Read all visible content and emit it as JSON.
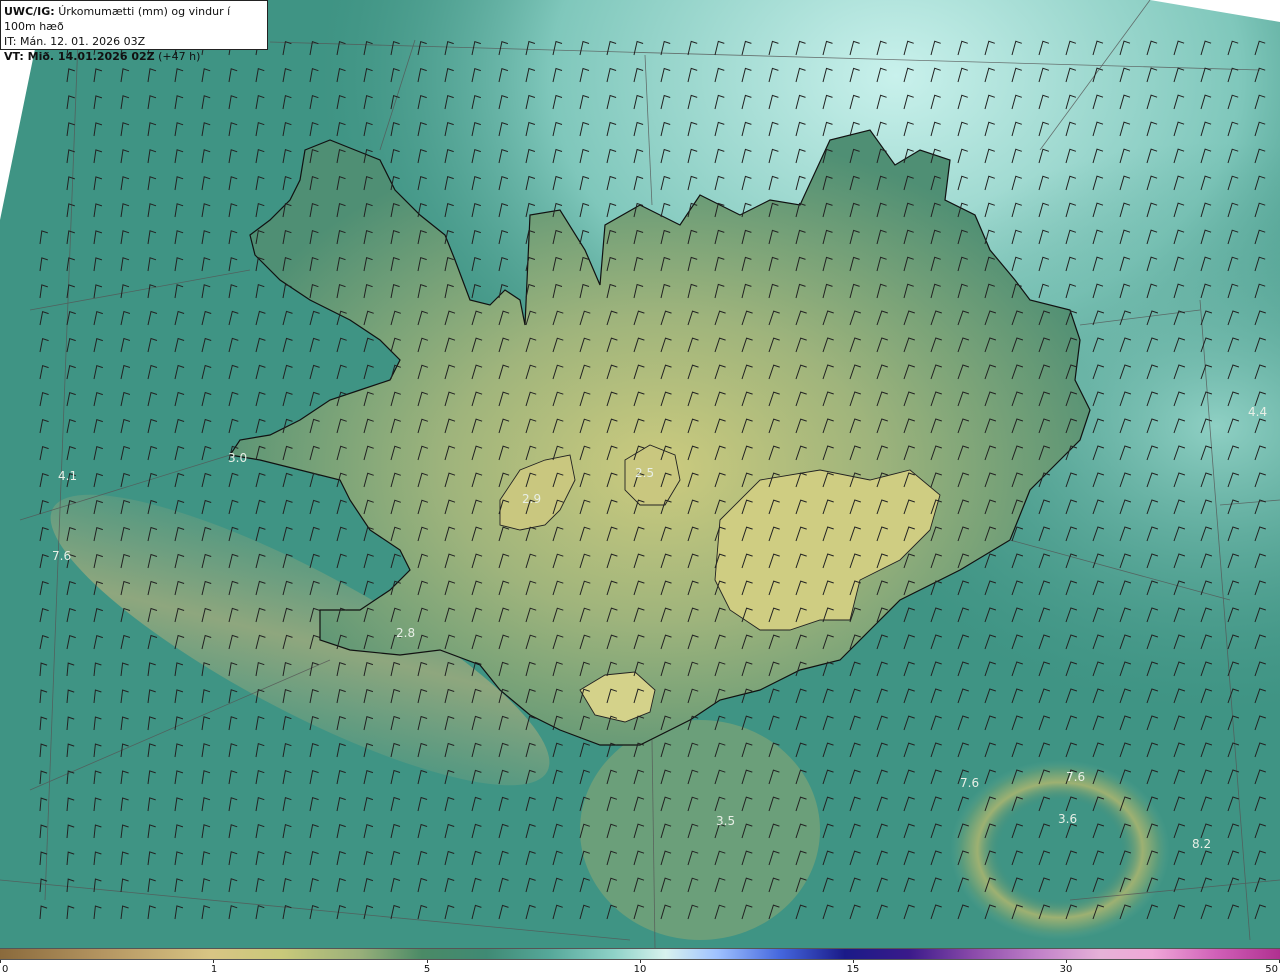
{
  "header": {
    "model_label": "UWC/IG:",
    "title": "Úrkomumætti (mm) og vindur í 100m hæð",
    "issue_time": "IT: Mán. 12. 01. 2026 03Z",
    "valid_label": "VT: Mið. 14.01.2026 02Z",
    "valid_offset": "(+47 h)"
  },
  "map_labels": [
    {
      "text": "3.0"
    },
    {
      "text": "4.1"
    },
    {
      "text": "7.6"
    },
    {
      "text": "2.9"
    },
    {
      "text": "2.5"
    },
    {
      "text": "2.8"
    },
    {
      "text": "4.4"
    },
    {
      "text": "3.5"
    },
    {
      "text": "7.6"
    },
    {
      "text": "3.6"
    },
    {
      "text": "7.6"
    },
    {
      "text": "8.2"
    }
  ],
  "colorbar": {
    "ticks": [
      "0",
      "1",
      "5",
      "10",
      "15",
      "30",
      "50"
    ]
  },
  "colors": {
    "ocean_teal": "#3f9484",
    "land_yellow": "#c8c77c",
    "coast_line": "#111111"
  }
}
